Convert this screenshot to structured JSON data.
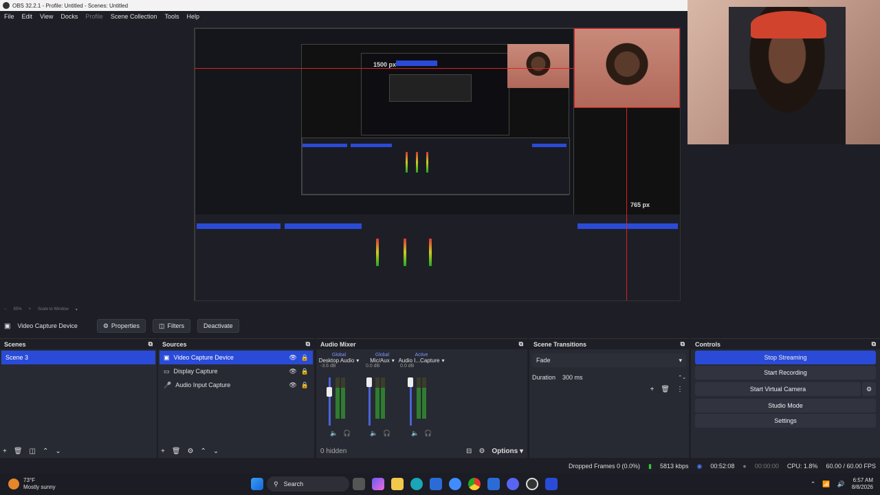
{
  "window": {
    "title": "OBS 32.2.1 - Profile: Untitled - Scenes: Untitled"
  },
  "menu": [
    "File",
    "Edit",
    "View",
    "Docks",
    "Profile",
    "Scene Collection",
    "Tools",
    "Help"
  ],
  "preview": {
    "label_h": "1500 px",
    "label_v": "765 px",
    "inner_label_h": "1500 px",
    "inner_label_v": "765 px"
  },
  "zoom": {
    "value": "55%",
    "mode": "Scale to Window"
  },
  "source_toolbar": {
    "source_name": "Video Capture Device",
    "properties": "Properties",
    "filters": "Filters",
    "deactivate": "Deactivate"
  },
  "scenes": {
    "title": "Scenes",
    "items": [
      "Scene 3"
    ]
  },
  "sources": {
    "title": "Sources",
    "items": [
      "Video Capture Device",
      "Display Capture",
      "Audio Input Capture"
    ]
  },
  "mixer": {
    "title": "Audio Mixer",
    "channels": [
      {
        "tag": "Global",
        "name": "Desktop Audio",
        "db": "-3.6 dB"
      },
      {
        "tag": "Global",
        "name": "Mic/Aux",
        "db": "0.0 dB"
      },
      {
        "tag": "Active",
        "name": "Audio I...Capture",
        "db": "0.0 dB"
      }
    ],
    "hidden": "0 hidden",
    "options": "Options"
  },
  "transitions": {
    "title": "Scene Transitions",
    "selected": "Fade",
    "duration_label": "Duration",
    "duration_value": "300 ms"
  },
  "controls": {
    "title": "Controls",
    "buttons": [
      "Stop Streaming",
      "Start Recording",
      "Start Virtual Camera",
      "Studio Mode",
      "Settings"
    ]
  },
  "status": {
    "dropped": "Dropped Frames 0 (0.0%)",
    "kbps": "5813 kbps",
    "stream_time": "00:52:08",
    "rec_time": "00:00:00",
    "cpu": "CPU: 1.8%",
    "fps": "60.00 / 60.00 FPS"
  },
  "taskbar": {
    "weather_temp": "73°F",
    "weather_desc": "Mostly sunny",
    "search": "Search",
    "time": "6:57 AM",
    "date": "8/8/2026"
  },
  "colors": {
    "accent": "#2a4bd7",
    "guide": "#e02020",
    "bg": "#1e1f26"
  }
}
